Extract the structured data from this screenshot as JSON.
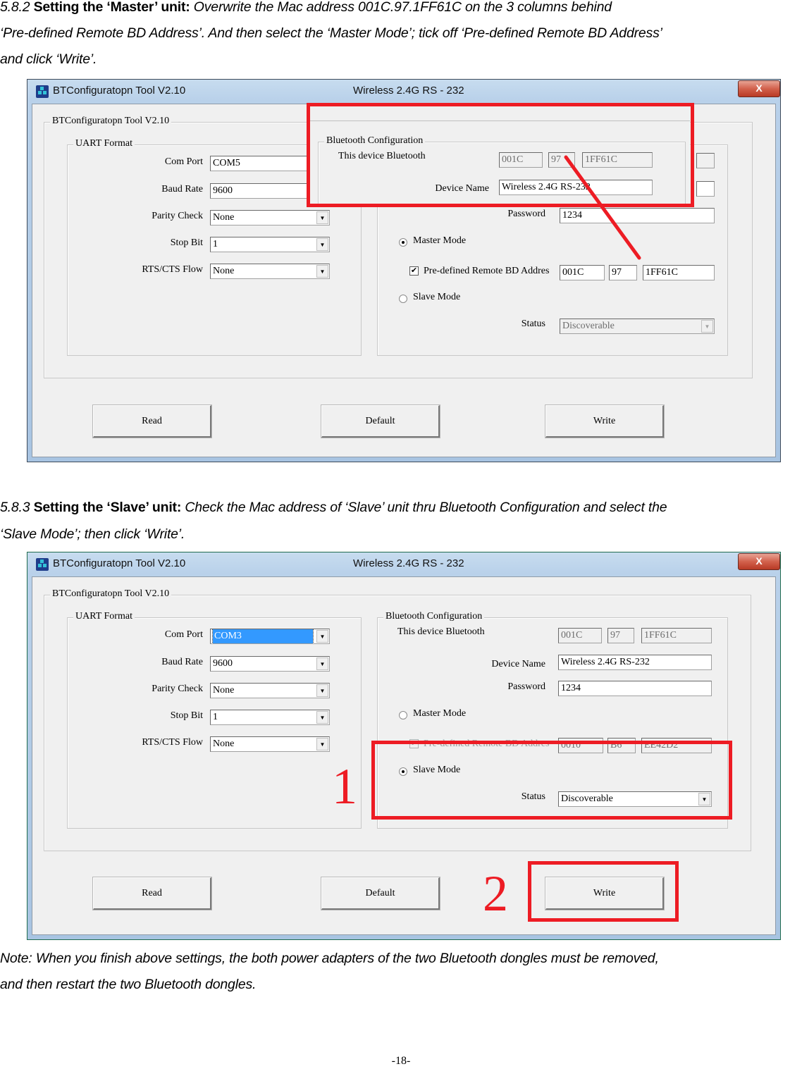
{
  "section_582": {
    "number": "5.8.2",
    "heading": "Setting the ‘Master’ unit:",
    "text_line1": "Overwrite the Mac address 001C.97.1FF61C on the 3 columns behind",
    "text_line2": "‘Pre-defined Remote BD Address’. And then select the ‘Master Mode’; tick off ‘Pre-defined Remote BD Address’",
    "text_line3": "and click ‘Write’."
  },
  "section_583": {
    "number": "5.8.3",
    "heading": "Setting the ‘Slave’ unit:",
    "text_line1": "Check the Mac address of ‘Slave’ unit thru Bluetooth Configuration and select the",
    "text_line2": "‘Slave Mode’; then click ‘Write’."
  },
  "note": {
    "line1": "Note: When you finish above settings, the both power adapters of the two Bluetooth dongles must be removed,",
    "line2": "and then restart the two Bluetooth dongles."
  },
  "page_number": "-18-",
  "annotation_color": "#ed1c24",
  "screenshots": [
    {
      "window_title": "BTConfiguratopn Tool V2.10",
      "window_caption": "Wireless 2.4G RS - 232",
      "close_label": "X",
      "outer_group": "BTConfiguratopn Tool V2.10",
      "uart": {
        "legend": "UART Format",
        "com_port_label": "Com Port",
        "com_port": "COM5",
        "baud_rate_label": "Baud Rate",
        "baud_rate": "9600",
        "parity_label": "Parity Check",
        "parity": "None",
        "stop_bit_label": "Stop Bit",
        "stop_bit": "1",
        "flow_label": "RTS/CTS Flow",
        "flow": "None"
      },
      "bt": {
        "legend": "Bluetooth Configuration",
        "this_device_label": "This device Bluetooth",
        "addr1": "001C",
        "addr2": "97",
        "addr3": "1FF61C",
        "device_name_label": "Device Name",
        "device_name": "Wireless 2.4G RS-232",
        "password_label": "Password",
        "password": "1234",
        "master_mode_label": "Master Mode",
        "predefined_label": "Pre-defined Remote BD Addres",
        "remote1": "001C",
        "remote2": "97",
        "remote3": "1FF61C",
        "slave_mode_label": "Slave Mode",
        "status_label": "Status",
        "status": "Discoverable"
      },
      "buttons": {
        "read": "Read",
        "default": "Default",
        "write": "Write"
      }
    },
    {
      "window_title": "BTConfiguratopn Tool V2.10",
      "window_caption": "Wireless 2.4G RS - 232",
      "close_label": "X",
      "outer_group": "BTConfiguratopn Tool V2.10",
      "uart": {
        "legend": "UART Format",
        "com_port_label": "Com Port",
        "com_port": "COM3",
        "baud_rate_label": "Baud Rate",
        "baud_rate": "9600",
        "parity_label": "Parity Check",
        "parity": "None",
        "stop_bit_label": "Stop Bit",
        "stop_bit": "1",
        "flow_label": "RTS/CTS Flow",
        "flow": "None"
      },
      "bt": {
        "legend": "Bluetooth Configuration",
        "this_device_label": "This device Bluetooth",
        "addr1": "001C",
        "addr2": "97",
        "addr3": "1FF61C",
        "device_name_label": "Device Name",
        "device_name": "Wireless 2.4G RS-232",
        "password_label": "Password",
        "password": "1234",
        "master_mode_label": "Master Mode",
        "predefined_label": "Pre-defined Remote BD Addres",
        "remote1": "0010",
        "remote2": "B6",
        "remote3": "EE42D2",
        "slave_mode_label": "Slave Mode",
        "status_label": "Status",
        "status": "Discoverable"
      },
      "buttons": {
        "read": "Read",
        "default": "Default",
        "write": "Write"
      },
      "step_labels": [
        "1",
        "2"
      ]
    }
  ]
}
